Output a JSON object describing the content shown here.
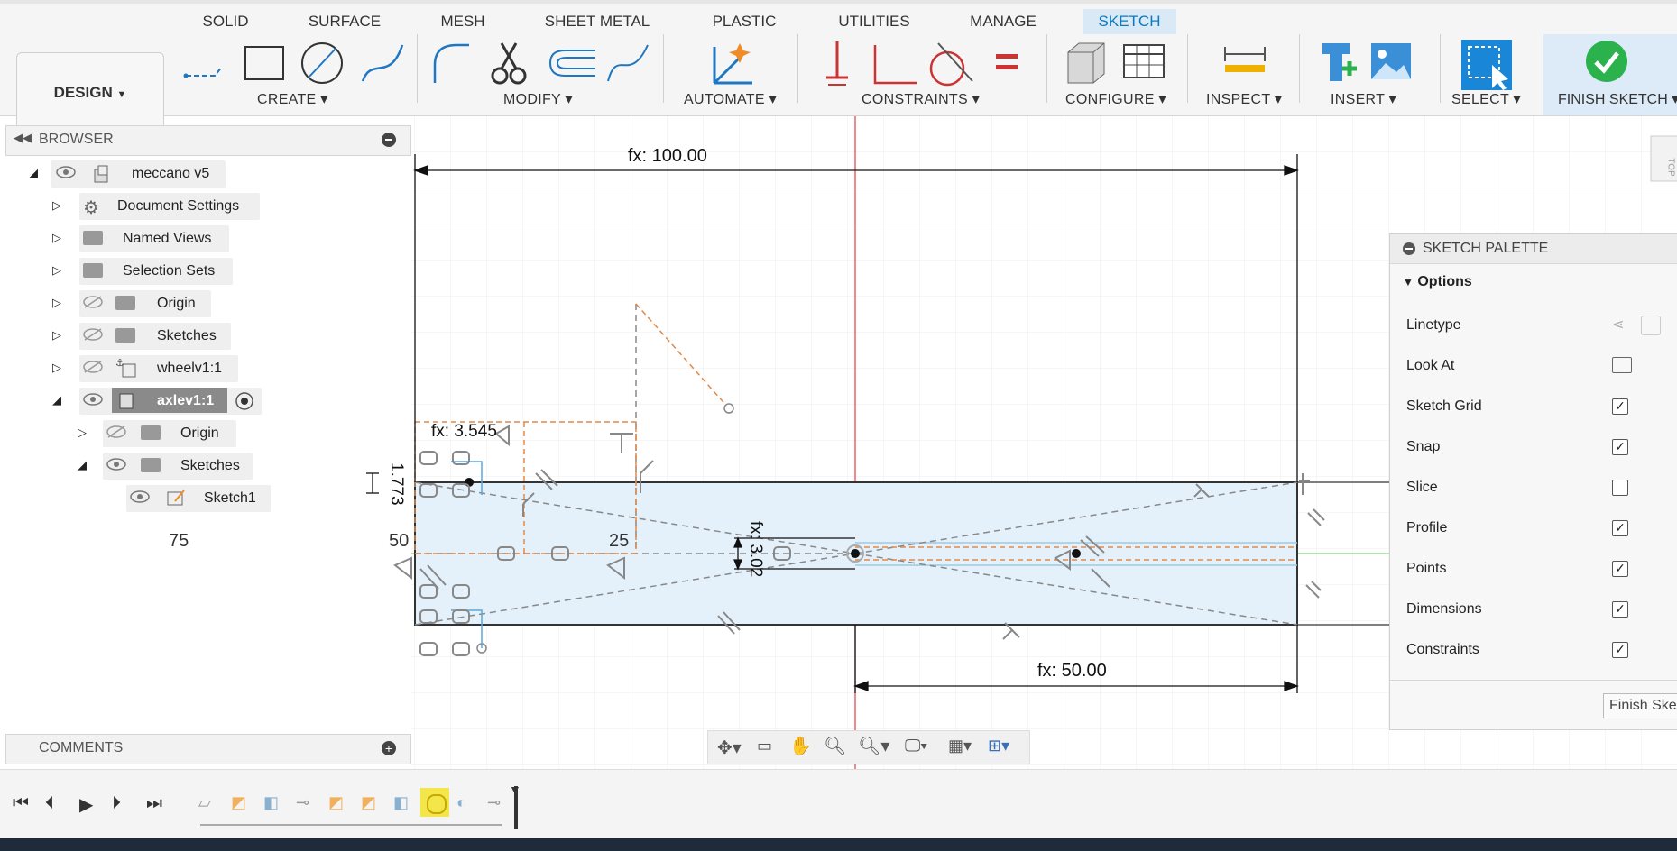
{
  "tabs": [
    "SOLID",
    "SURFACE",
    "MESH",
    "SHEET METAL",
    "PLASTIC",
    "UTILITIES",
    "MANAGE",
    "SKETCH"
  ],
  "active_tab": "SKETCH",
  "workspace": {
    "label": "DESIGN"
  },
  "toolbar_groups": {
    "create": "CREATE",
    "modify": "MODIFY",
    "automate": "AUTOMATE",
    "constraints": "CONSTRAINTS",
    "configure": "CONFIGURE",
    "inspect": "INSPECT",
    "insert": "INSERT",
    "select": "SELECT",
    "finish": "FINISH SKETCH"
  },
  "browser": {
    "title": "BROWSER",
    "items": [
      {
        "label": "meccano v5"
      },
      {
        "label": "Document Settings"
      },
      {
        "label": "Named Views"
      },
      {
        "label": "Selection Sets"
      },
      {
        "label": "Origin"
      },
      {
        "label": "Sketches"
      },
      {
        "label": "wheelv1:1"
      },
      {
        "label": "axlev1:1"
      },
      {
        "label": "Origin"
      },
      {
        "label": "Sketches"
      },
      {
        "label": "Sketch1"
      }
    ]
  },
  "comments": {
    "title": "COMMENTS"
  },
  "sketch_palette": {
    "title": "SKETCH PALETTE",
    "section": "Options",
    "rows": [
      {
        "label": "Linetype"
      },
      {
        "label": "Look At"
      },
      {
        "label": "Sketch Grid",
        "checked": true
      },
      {
        "label": "Snap",
        "checked": true
      },
      {
        "label": "Slice",
        "checked": false
      },
      {
        "label": "Profile",
        "checked": true
      },
      {
        "label": "Points",
        "checked": true
      },
      {
        "label": "Dimensions",
        "checked": true
      },
      {
        "label": "Constraints",
        "checked": true
      }
    ],
    "finish_button": "Finish Ske"
  },
  "canvas": {
    "dim_top": "fx: 100.00",
    "dim_bottom": "fx: 50.00",
    "dim_small": "fx: 3.545",
    "dim_vert_left": "1.773",
    "dim_vert_center": "fx: 3.02",
    "grid_75": "75",
    "grid_50": "50",
    "grid_25": "25",
    "viewcube": "TOP"
  },
  "colors": {
    "accent": "#0b7ac0",
    "axis_red": "#e04040",
    "axis_green": "#7fd07f",
    "profile_fill": "#e4f1fb",
    "construction": "#e08a4a"
  }
}
